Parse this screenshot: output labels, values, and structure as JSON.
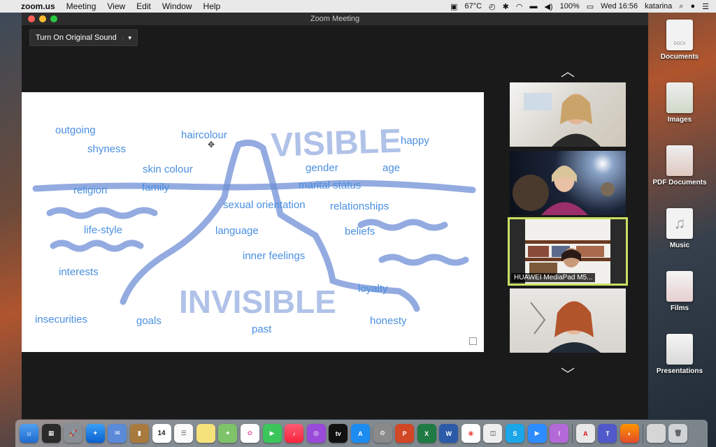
{
  "menubar": {
    "apple": "",
    "app": "zoom.us",
    "items": [
      "Meeting",
      "View",
      "Edit",
      "Window",
      "Help"
    ],
    "temperature": "67°C",
    "battery": "100%",
    "clock": "Wed 16:56",
    "user": "katarina"
  },
  "window": {
    "title": "Zoom Meeting",
    "sound_button": "Turn On Original Sound"
  },
  "whiteboard": {
    "words": [
      "outgoing",
      "shyness",
      "haircolour",
      "happy",
      "skin colour",
      "gender",
      "age",
      "religion",
      "family",
      "marital status",
      "sexual orientation",
      "relationships",
      "life-style",
      "language",
      "beliefs",
      "inner feelings",
      "interests",
      "loyalty",
      "insecurities",
      "goals",
      "past",
      "honesty"
    ],
    "visible_label": "VISIBLE",
    "invisible_label": "INVISIBLE"
  },
  "participants": [
    {
      "name": ""
    },
    {
      "name": ""
    },
    {
      "name": "HUAWEI MediaPad M5..."
    },
    {
      "name": ""
    }
  ],
  "desktop_icons": [
    "Documents",
    "Images",
    "PDF Documents",
    "Music",
    "Films",
    "Presentations"
  ],
  "desktop_icon_badges": {
    "docx": "DOCX"
  },
  "dock": {
    "calendar_day": "14",
    "tv_label": "tv"
  },
  "colors": {
    "accent": "#4a8fe0",
    "highlight": "#c7e163",
    "stroke": "#6f8fd6"
  }
}
